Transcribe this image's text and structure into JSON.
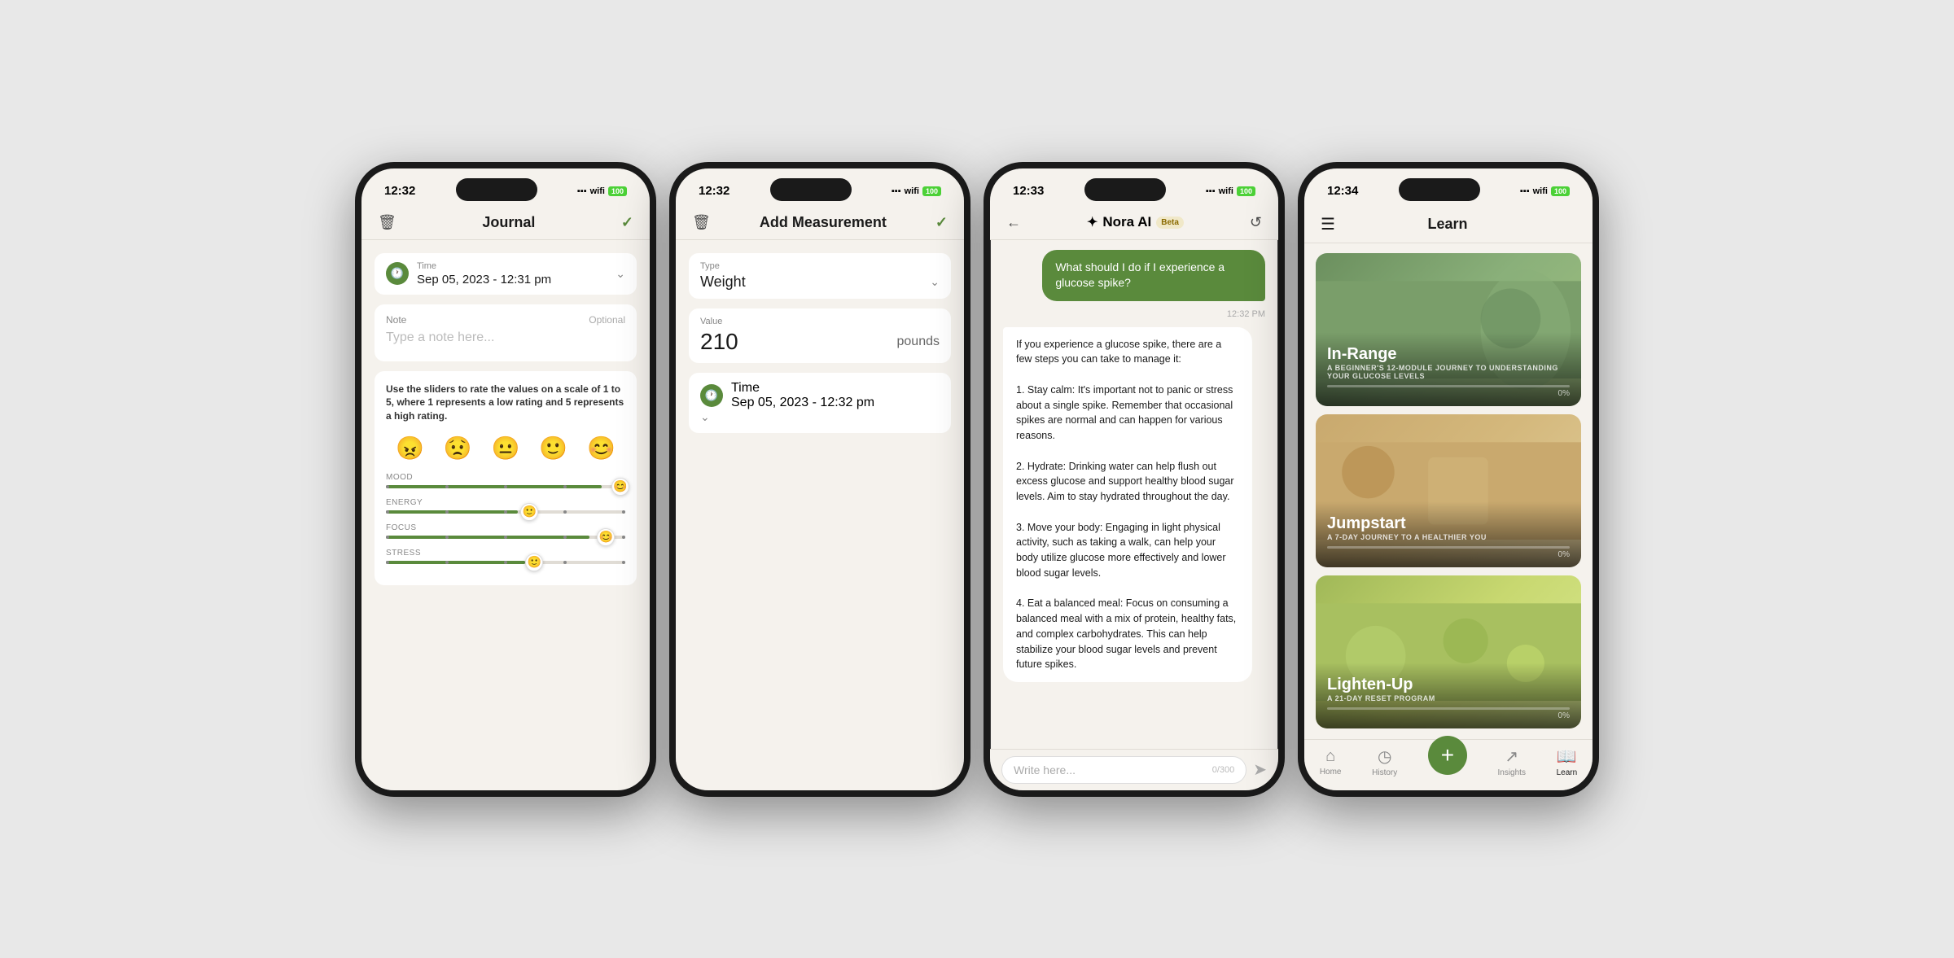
{
  "phone1": {
    "status_time": "12:32",
    "nav_title": "Journal",
    "time_label": "Time",
    "time_value": "Sep 05, 2023 - 12:31 pm",
    "note_label": "Note",
    "note_optional": "Optional",
    "note_placeholder": "Type a note here...",
    "rating_instruction": "Use the sliders to rate the values on a scale of 1 to 5, where 1 represents a low rating and 5 represents a high rating.",
    "emojis": [
      "😠",
      "😟",
      "😐",
      "🙂",
      "😊"
    ],
    "sliders": [
      {
        "label": "MOOD",
        "fill": "90%",
        "emoji": "😊"
      },
      {
        "label": "ENERGY",
        "fill": "55%",
        "emoji": "🙂"
      },
      {
        "label": "FOCUS",
        "fill": "85%",
        "emoji": "😊"
      },
      {
        "label": "STRESS",
        "fill": "58%",
        "emoji": "🙂"
      }
    ]
  },
  "phone2": {
    "status_time": "12:32",
    "nav_title": "Add Measurement",
    "type_label": "Type",
    "type_value": "Weight",
    "value_label": "Value",
    "value_number": "210",
    "value_unit": "pounds",
    "time_label": "Time",
    "time_value": "Sep 05, 2023 - 12:32 pm"
  },
  "phone3": {
    "status_time": "12:33",
    "ai_name": "Nora AI",
    "beta_label": "Beta",
    "user_message": "What should I do if I experience a glucose spike?",
    "message_time": "12:32 PM",
    "ai_response": "If you experience a glucose spike, there are a few steps you can take to manage it:\n\n1. Stay calm: It's important not to panic or stress about a single spike. Remember that occasional spikes are normal and can happen for various reasons.\n\n2. Hydrate: Drinking water can help flush out excess glucose and support healthy blood sugar levels. Aim to stay hydrated throughout the day.\n\n3. Move your body: Engaging in light physical activity, such as taking a walk, can help your body utilize glucose more effectively and lower blood sugar levels.\n\n4. Eat a balanced meal: Focus on consuming a balanced meal with a mix of protein, healthy fats, and complex carbohydrates. This can help stabilize your blood sugar levels and prevent future spikes.",
    "input_placeholder": "Write here...",
    "char_count": "0/300"
  },
  "phone4": {
    "status_time": "12:34",
    "nav_title": "Learn",
    "courses": [
      {
        "title": "In-Range",
        "subtitle": "A BEGINNER'S 12-MODULE JOURNEY TO UNDERSTANDING YOUR GLUCOSE LEVELS",
        "progress": 0,
        "progress_label": "0%"
      },
      {
        "title": "Jumpstart",
        "subtitle": "A 7-DAY JOURNEY TO A HEALTHIER YOU",
        "progress": 0,
        "progress_label": "0%"
      },
      {
        "title": "Lighten-Up",
        "subtitle": "A 21-DAY RESET PROGRAM",
        "progress": 0,
        "progress_label": "0%"
      }
    ],
    "tabs": [
      {
        "label": "Home",
        "icon": "⌂"
      },
      {
        "label": "History",
        "icon": "◷"
      },
      {
        "label": "+",
        "icon": "+"
      },
      {
        "label": "Insights",
        "icon": "↗"
      },
      {
        "label": "Learn",
        "icon": "📖"
      }
    ]
  }
}
